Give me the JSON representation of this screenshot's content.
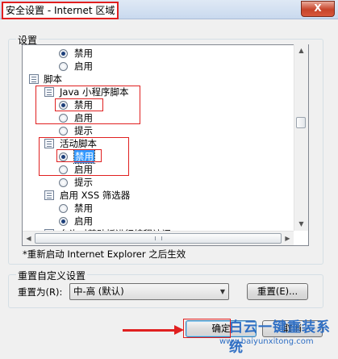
{
  "window": {
    "title": "安全设置 - Internet 区域",
    "close_label": "X"
  },
  "settings_group": {
    "label": "设置"
  },
  "tree": {
    "rows": [
      {
        "type": "radio",
        "label": "禁用",
        "checked": true
      },
      {
        "type": "radio",
        "label": "启用",
        "checked": false
      },
      {
        "type": "folder",
        "label": "脚本"
      },
      {
        "type": "folder",
        "label": "Java 小程序脚本"
      },
      {
        "type": "radio",
        "label": "禁用",
        "checked": true
      },
      {
        "type": "radio",
        "label": "启用",
        "checked": false
      },
      {
        "type": "radio",
        "label": "提示",
        "checked": false
      },
      {
        "type": "folder",
        "label": "活动脚本"
      },
      {
        "type": "radio",
        "label": "禁用",
        "checked": true,
        "selected": true
      },
      {
        "type": "radio",
        "label": "启用",
        "checked": false
      },
      {
        "type": "radio",
        "label": "提示",
        "checked": false
      },
      {
        "type": "folder",
        "label": "启用 XSS 筛选器"
      },
      {
        "type": "radio",
        "label": "禁用",
        "checked": false
      },
      {
        "type": "radio",
        "label": "启用",
        "checked": true
      },
      {
        "type": "folder",
        "label": "允许对剪贴板进行编程访问"
      }
    ]
  },
  "note": "*重新启动 Internet Explorer 之后生效",
  "reset_group": {
    "label": "重置自定义设置",
    "reset_to_label": "重置为(R):",
    "combo_value": "中-高 (默认)",
    "reset_button": "重置(E)..."
  },
  "footer": {
    "ok_label": "确定",
    "cancel_label": "取消"
  },
  "watermark": {
    "line1": "白云一键重装系统",
    "line2": "www.baiyunxitong.com"
  },
  "colors": {
    "highlight": "#e02020",
    "selection": "#3399ff",
    "watermark": "#2f6fc4"
  }
}
